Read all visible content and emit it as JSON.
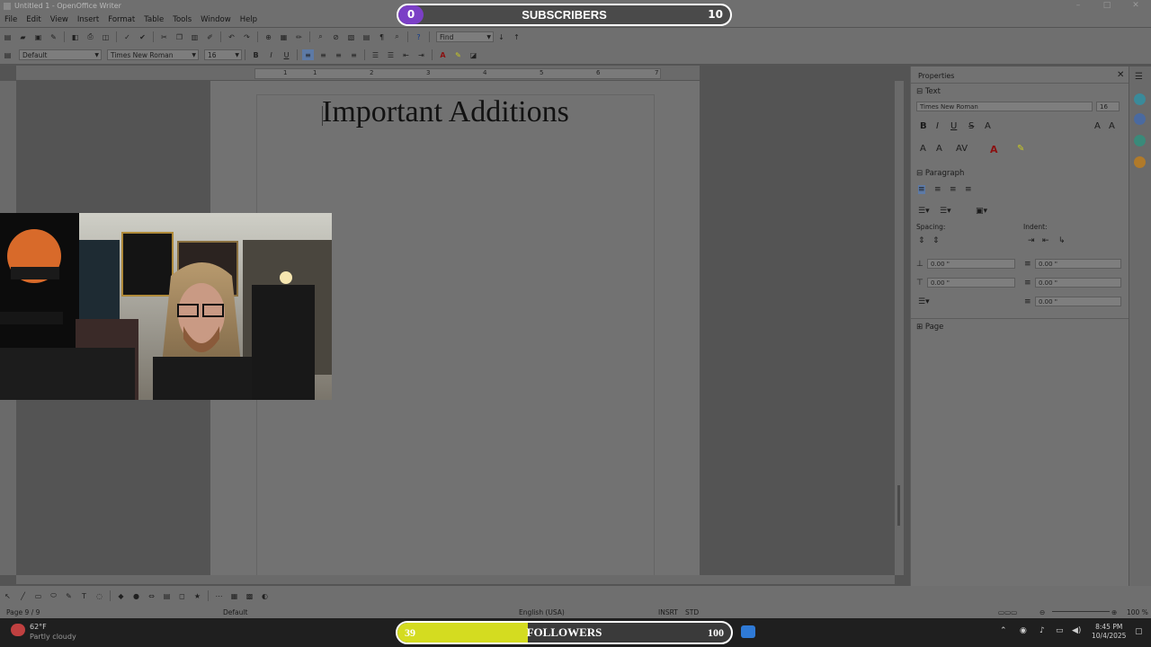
{
  "window": {
    "title": "Untitled 1 - OpenOffice Writer"
  },
  "menu": [
    "File",
    "Edit",
    "View",
    "Insert",
    "Format",
    "Table",
    "Tools",
    "Window",
    "Help"
  ],
  "standard_toolbar": {
    "find_placeholder": "Find"
  },
  "formatting_toolbar": {
    "paragraph_style": "Default",
    "font_name": "Times New Roman",
    "font_size": "16",
    "bold": "B",
    "italic": "I",
    "underline": "U"
  },
  "ruler": {
    "numbers": [
      "1",
      "1",
      "2",
      "3",
      "4",
      "5",
      "6",
      "7"
    ]
  },
  "document": {
    "heading": "Important Additions"
  },
  "sidebar": {
    "title": "Properties",
    "text_section": "Text",
    "font_name": "Times New Roman",
    "font_size": "16",
    "paragraph_section": "Paragraph",
    "spacing_label": "Spacing:",
    "indent_label": "Indent:",
    "spacing_above": "0.00 \"",
    "spacing_below": "0.00 \"",
    "indent_before": "0.00 \"",
    "indent_after": "0.00 \"",
    "indent_first": "0.00 \"",
    "page_section": "Page"
  },
  "status": {
    "page": "Page 9 / 9",
    "style": "Default",
    "language": "English (USA)",
    "insert_mode": "INSRT",
    "selection_mode": "STD",
    "zoom": "100 %"
  },
  "taskbar": {
    "weather_temp": "62°F",
    "weather_desc": "Partly cloudy",
    "time": "8:45 PM",
    "date": "10/4/2025"
  },
  "overlay": {
    "subscribers": {
      "label": "SUBSCRIBERS",
      "current": "0",
      "goal": "10",
      "progress": 0.0
    },
    "followers": {
      "label": "FOLLOWERS",
      "current": "39",
      "goal": "100",
      "progress": 0.39
    }
  },
  "colors": {
    "subscriber_badge": "#7b3fc6",
    "follower_fill": "#d4dc20",
    "taskbar": "#1f1f1f"
  }
}
